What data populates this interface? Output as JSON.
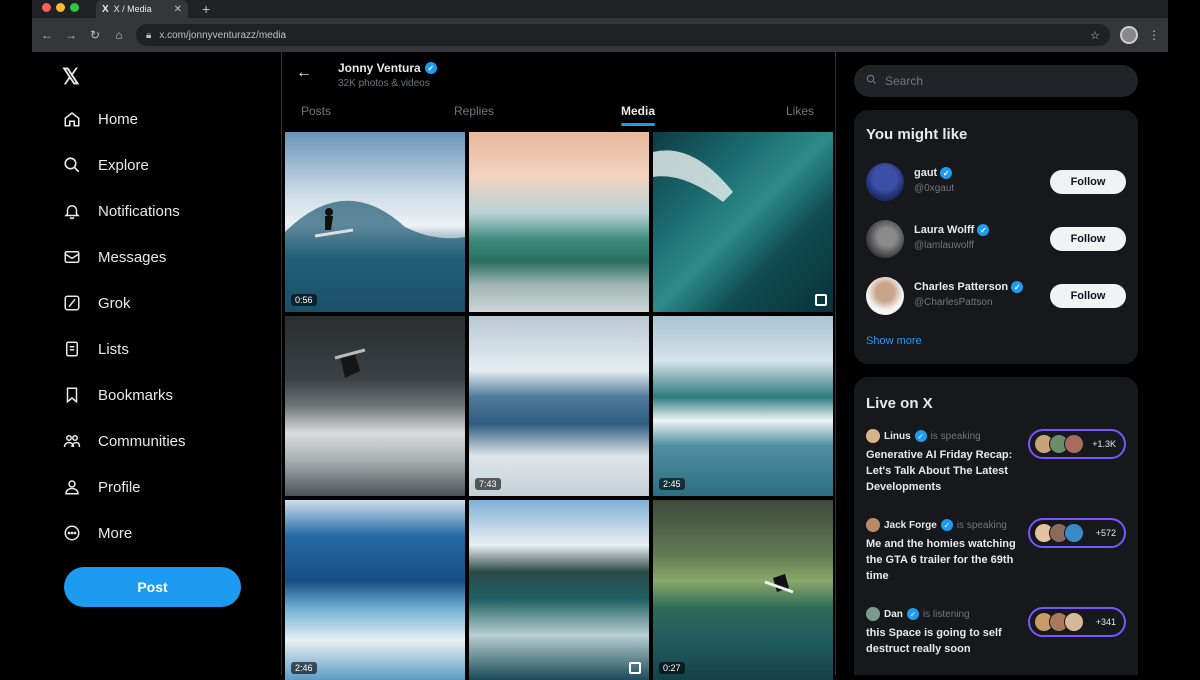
{
  "browser": {
    "tab_title": "X / Media",
    "tab_icon": "X",
    "url": "x.com/jonnyventurazz/media"
  },
  "nav": {
    "items": [
      {
        "label": "Home",
        "icon": "home-icon"
      },
      {
        "label": "Explore",
        "icon": "search-icon"
      },
      {
        "label": "Notifications",
        "icon": "bell-icon"
      },
      {
        "label": "Messages",
        "icon": "mail-icon"
      },
      {
        "label": "Grok",
        "icon": "grok-icon"
      },
      {
        "label": "Lists",
        "icon": "list-icon"
      },
      {
        "label": "Bookmarks",
        "icon": "bookmark-icon"
      },
      {
        "label": "Communities",
        "icon": "communities-icon"
      },
      {
        "label": "Profile",
        "icon": "profile-icon"
      },
      {
        "label": "More",
        "icon": "more-icon"
      }
    ],
    "post_label": "Post"
  },
  "profile": {
    "name": "Jonny Ventura",
    "subtitle": "32K photos & videos",
    "tabs": [
      "Posts",
      "Replies",
      "Media",
      "Likes"
    ],
    "active_tab": "Media"
  },
  "media": [
    {
      "duration": "0:56"
    },
    {
      "duration": ""
    },
    {
      "duration": ""
    },
    {
      "duration": ""
    },
    {
      "duration": "7:43"
    },
    {
      "duration": "2:45"
    },
    {
      "duration": "2:46"
    },
    {
      "duration": ""
    },
    {
      "duration": "0:27"
    }
  ],
  "search": {
    "placeholder": "Search"
  },
  "might_like": {
    "title": "You might like",
    "users": [
      {
        "name": "gaut",
        "handle": "@0xgaut",
        "follow_label": "Follow"
      },
      {
        "name": "Laura Wolff",
        "handle": "@lamlauwolff",
        "follow_label": "Follow"
      },
      {
        "name": "Charles Patterson",
        "handle": "@CharlesPattson",
        "follow_label": "Follow"
      }
    ],
    "show_more": "Show more"
  },
  "live": {
    "title": "Live on X",
    "spaces": [
      {
        "host": "Linus",
        "status": "is speaking",
        "title": "Generative AI Friday Recap: Let's Talk About The Latest Developments",
        "count": "+1.3K"
      },
      {
        "host": "Jack Forge",
        "status": "is speaking",
        "title": "Me and the homies watching the GTA 6 trailer for the 69th time",
        "count": "+572"
      },
      {
        "host": "Dan",
        "status": "is listening",
        "title": "this Space is going to self destruct really soon",
        "count": "+341"
      }
    ]
  },
  "colors": {
    "accent": "#1d9bf0",
    "space_border": "#7856ff",
    "background": "#000000",
    "card": "#16181c"
  }
}
